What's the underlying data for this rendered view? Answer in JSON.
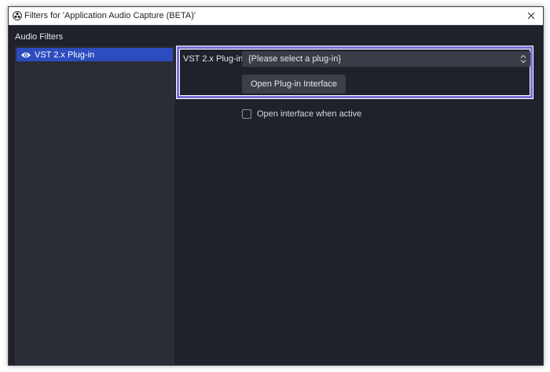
{
  "window": {
    "title": "Filters for 'Application Audio Capture (BETA)'"
  },
  "filters": {
    "section_label": "Audio Filters",
    "items": [
      {
        "label": "VST 2.x Plug-in",
        "visible": true,
        "selected": true
      }
    ]
  },
  "properties": {
    "plugin_label": "VST 2.x Plug-in",
    "plugin_select_value": "{Please select a plug-in}",
    "open_interface_button": "Open Plug-in Interface",
    "open_when_active_label": "Open interface when active",
    "open_when_active_checked": false
  },
  "colors": {
    "selection": "#2c4cbf",
    "highlight": "#7b70d9",
    "background": "#1f222b"
  },
  "icons": {
    "app": "obs-logo-icon",
    "close": "close-icon",
    "visibility": "eye-icon",
    "select": "chevron-updown-icon"
  }
}
